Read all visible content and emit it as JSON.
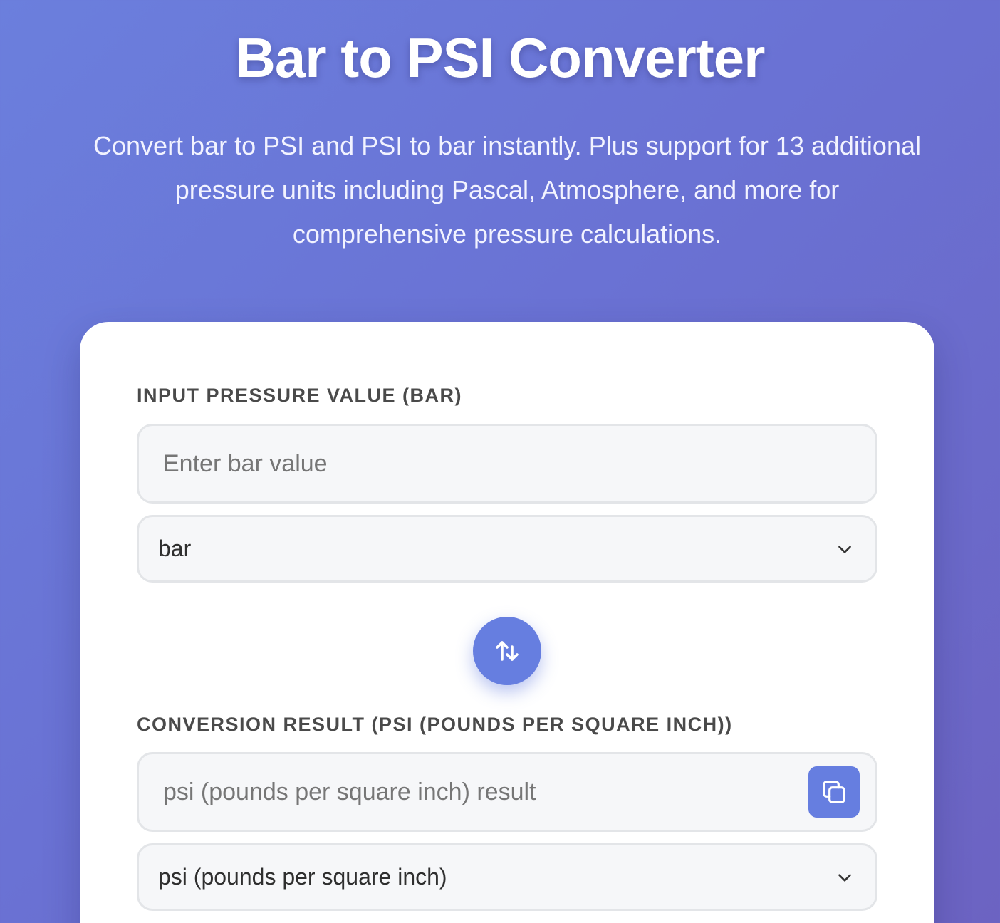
{
  "header": {
    "title": "Bar to PSI Converter",
    "subtitle": "Convert bar to PSI and PSI to bar instantly. Plus support for 13 additional pressure units including Pascal, Atmosphere, and more for comprehensive pressure calculations."
  },
  "converter": {
    "input_label": "Input Pressure Value (bar)",
    "input_placeholder": "Enter bar value",
    "input_value": "",
    "from_unit": "bar",
    "swap_icon": "swap-arrows-icon",
    "result_label": "Conversion Result (psi (pounds per square inch))",
    "result_placeholder": "psi (pounds per square inch) result",
    "result_value": "",
    "copy_icon": "copy-icon",
    "to_unit": "psi (pounds per square inch)"
  },
  "colors": {
    "accent": "#667ee0",
    "background_start": "#6b7fdd",
    "background_end": "#6c63c2",
    "card": "#ffffff",
    "field_bg": "#f6f7f9",
    "field_border": "#e3e5e8"
  }
}
